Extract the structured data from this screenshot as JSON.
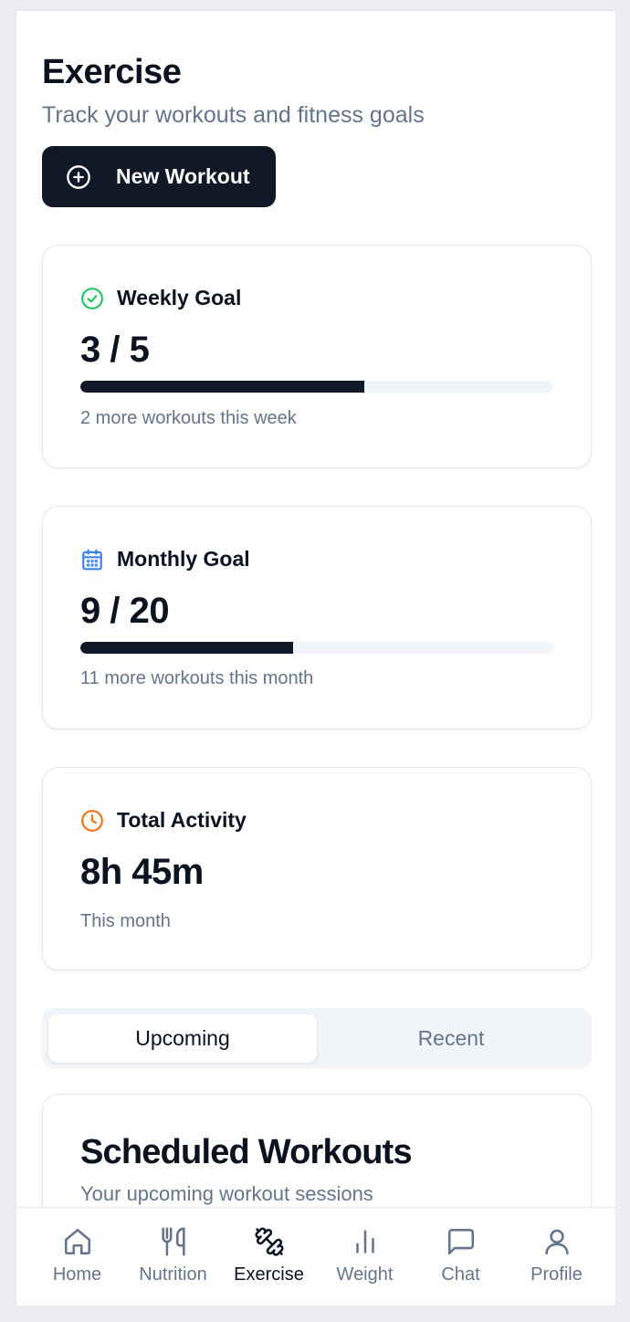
{
  "header": {
    "title": "Exercise",
    "subtitle": "Track your workouts and fitness goals",
    "new_workout_label": "New Workout"
  },
  "weekly_goal": {
    "label": "Weekly Goal",
    "value": "3 / 5",
    "progress_fraction": 0.6,
    "note": "2 more workouts this week",
    "icon": "check-circle-icon",
    "icon_color": "#22c55e"
  },
  "monthly_goal": {
    "label": "Monthly Goal",
    "value": "9 / 20",
    "progress_fraction": 0.45,
    "note": "11 more workouts this month",
    "icon": "calendar-icon",
    "icon_color": "#3b82f6"
  },
  "total_activity": {
    "label": "Total Activity",
    "value": "8h 45m",
    "note": "This month",
    "icon": "clock-icon",
    "icon_color": "#f97316"
  },
  "tabs": [
    {
      "label": "Upcoming",
      "active": true
    },
    {
      "label": "Recent",
      "active": false
    }
  ],
  "scheduled": {
    "title": "Scheduled Workouts",
    "subtitle": "Your upcoming workout sessions"
  },
  "nav": [
    {
      "label": "Home",
      "icon": "home-icon",
      "active": false
    },
    {
      "label": "Nutrition",
      "icon": "utensils-icon",
      "active": false
    },
    {
      "label": "Exercise",
      "icon": "dumbbell-icon",
      "active": true
    },
    {
      "label": "Weight",
      "icon": "bar-chart-icon",
      "active": false
    },
    {
      "label": "Chat",
      "icon": "chat-icon",
      "active": false
    },
    {
      "label": "Profile",
      "icon": "user-icon",
      "active": false
    }
  ],
  "colors": {
    "primary": "#111827",
    "muted_text": "#64748b",
    "track": "#f1f5f9"
  }
}
